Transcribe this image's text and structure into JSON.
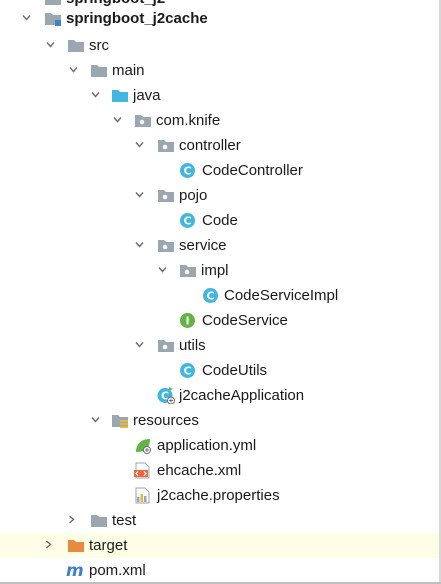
{
  "tree": {
    "top_cut_label": "springboot_j2",
    "project": "springboot_j2cache",
    "src": "src",
    "main": "main",
    "java": "java",
    "package": "com.knife",
    "controller": "controller",
    "code_controller": "CodeController",
    "pojo": "pojo",
    "code": "Code",
    "service": "service",
    "impl": "impl",
    "code_service_impl": "CodeServiceImpl",
    "code_service": "CodeService",
    "utils": "utils",
    "code_utils": "CodeUtils",
    "app": "j2cacheApplication",
    "resources": "resources",
    "application_yml": "application.yml",
    "ehcache_xml": "ehcache.xml",
    "j2cache_props": "j2cache.properties",
    "test": "test",
    "target": "target",
    "pom": "pom.xml"
  },
  "colors": {
    "folder": "#9aa7b0",
    "source_folder": "#40b6e0",
    "excluded_folder": "#e88b40",
    "class_badge": "#40b6e0",
    "interface_badge": "#62b543",
    "highlight_row": "#fefee6"
  }
}
